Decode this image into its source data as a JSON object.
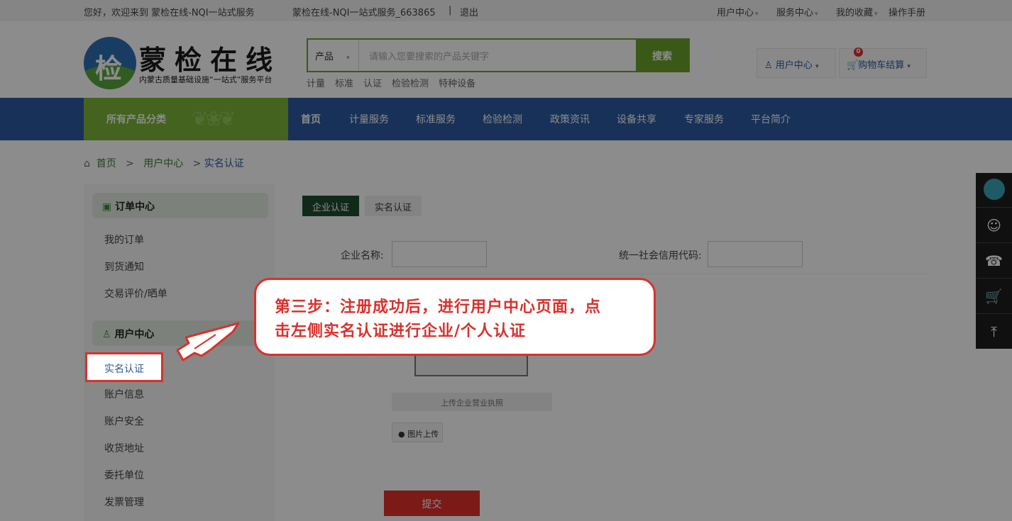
{
  "topbar": {
    "welcome": "您好，欢迎来到 蒙检在线-NQI一站式服务",
    "account": "蒙检在线-NQI一站式服务_663865",
    "separator": "|",
    "logout": "退出",
    "user_center": "用户中心",
    "service_center": "服务中心",
    "favorites": "我的收藏",
    "manual": "操作手册"
  },
  "header": {
    "logo_char": "检",
    "logo_title": "蒙检在线",
    "logo_subtitle": "内蒙古质量基础设施“一站式”服务平台",
    "search_category": "产品",
    "search_placeholder": "请输入您要搜索的产品关键字",
    "search_button": "搜索",
    "hot_links": [
      "计量",
      "标准",
      "认证",
      "检验检测",
      "特种设备"
    ],
    "user_center_btn": "用户中心",
    "cart_btn": "购物车结算",
    "cart_count": "0"
  },
  "nav": {
    "all_categories": "所有产品分类",
    "items": [
      "首页",
      "计量服务",
      "标准服务",
      "检验检测",
      "政策资讯",
      "设备共享",
      "专家服务",
      "平台简介"
    ]
  },
  "breadcrumb": {
    "home": "首页",
    "sep1": ">",
    "level1": "用户中心",
    "sep2": ">",
    "current": "实名认证"
  },
  "sidebar": {
    "order_center": "订单中心",
    "order_items": [
      "我的订单",
      "到货通知",
      "交易评价/晒单"
    ],
    "user_center": "用户中心",
    "user_items": [
      "实名认证",
      "账户信息",
      "账户安全",
      "收货地址",
      "委托单位",
      "发票管理"
    ]
  },
  "content": {
    "tabs": [
      "企业认证",
      "实名认证"
    ],
    "company_name_label": "企业名称:",
    "credit_code_label": "统一社会信用代码:",
    "upload_caption": "上传企业营业执照",
    "upload_button": "图片上传",
    "submit": "提交"
  },
  "callout": {
    "line1": "第三步：注册成功后，进行用户中心页面，点",
    "line2": "击左侧实名认证进行企业/个人认证"
  },
  "right_toolbar": [
    "avatar-icon",
    "chat-icon",
    "headset-icon",
    "cart-icon",
    "back-to-top-icon"
  ]
}
